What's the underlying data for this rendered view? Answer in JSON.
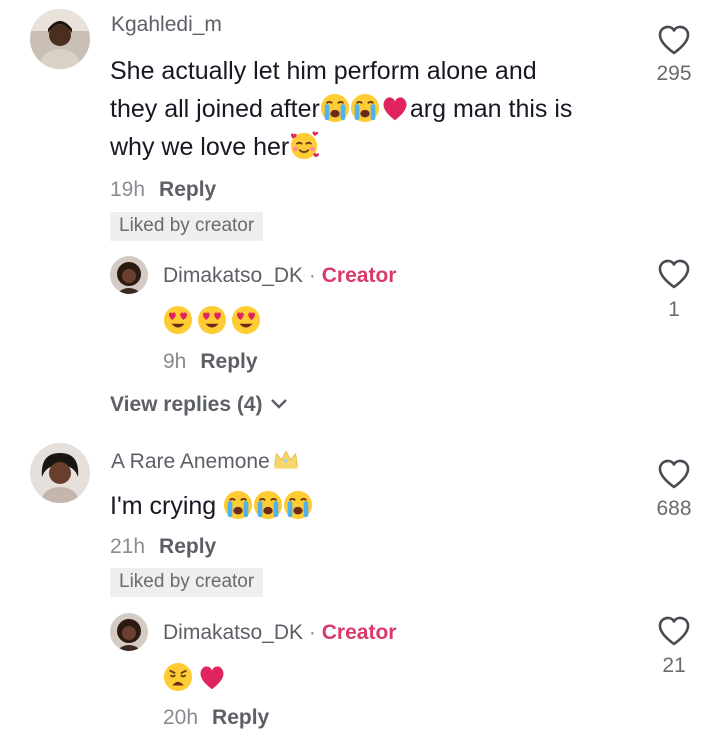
{
  "comments": [
    {
      "username": "Kgahledi_m",
      "text_line1": "She actually let him perform alone and",
      "text_line2_a": "they all joined after",
      "text_line2_emojis": [
        "loudly-crying-face",
        "loudly-crying-face",
        "red-heart"
      ],
      "text_line2_b": "arg man this is",
      "text_line3": "why we love her",
      "text_line3_emojis": [
        "smiling-face-with-hearts"
      ],
      "time": "19h",
      "reply_label": "Reply",
      "liked_label": "Liked by creator",
      "likes": "295",
      "reply": {
        "username": "Dimakatso_DK",
        "separator": "·",
        "tag": "Creator",
        "emojis": [
          "heart-eyes-face",
          "heart-eyes-face",
          "heart-eyes-face"
        ],
        "time": "9h",
        "reply_label": "Reply",
        "likes": "1"
      },
      "view_replies": "View replies (4)"
    },
    {
      "username": "A Rare Anemone",
      "username_emoji": "crown",
      "text": "I'm crying ",
      "text_emojis": [
        "loudly-crying-face",
        "loudly-crying-face",
        "loudly-crying-face"
      ],
      "time": "21h",
      "reply_label": "Reply",
      "liked_label": "Liked by creator",
      "likes": "688",
      "reply": {
        "username": "Dimakatso_DK",
        "separator": "·",
        "tag": "Creator",
        "emojis": [
          "weary-face",
          "red-heart"
        ],
        "time": "20h",
        "reply_label": "Reply",
        "likes": "21"
      }
    }
  ],
  "colors": {
    "creator_tag": "#d93a6a",
    "username": "#5c5f66",
    "meta": "#8a8b91",
    "liked_bg": "#efefef",
    "heart": "#e0245e",
    "emoji_yellow": "#ffcc33"
  }
}
